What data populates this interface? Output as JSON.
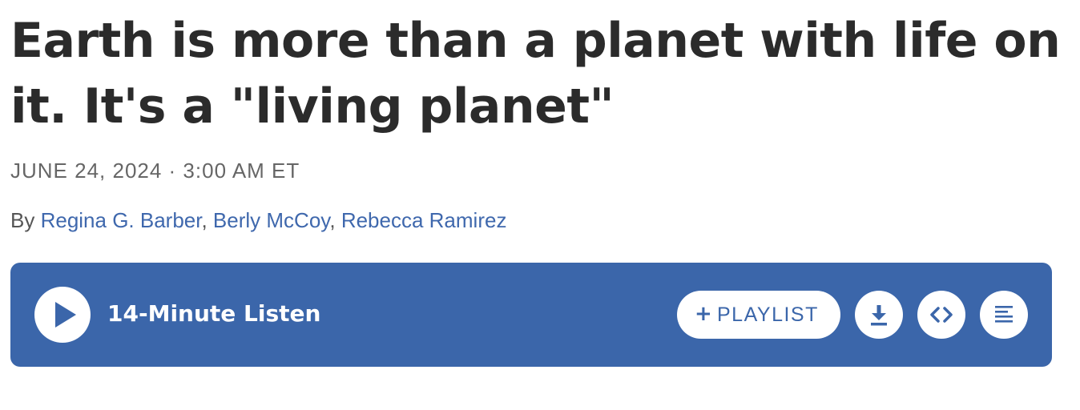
{
  "article": {
    "headline": "Earth is more than a planet with life on it. It's a \"living planet\"",
    "dateline": "JUNE 24, 2024 · 3:00 AM ET",
    "byline": {
      "prefix": "By ",
      "authors": [
        "Regina G. Barber",
        "Berly McCoy",
        "Rebecca Ramirez"
      ],
      "separator": ", "
    }
  },
  "player": {
    "listen_label": "14-Minute Listen",
    "playlist_plus": "+",
    "playlist_label": "PLAYLIST",
    "icons": {
      "play": "play-icon",
      "download": "download-icon",
      "embed": "embed-code-icon",
      "transcript": "transcript-icon"
    }
  },
  "colors": {
    "headline": "#2b2b2b",
    "dateline": "#666666",
    "link": "#3f68ad",
    "player_bg": "#3b66aa",
    "button_bg": "#ffffff"
  }
}
